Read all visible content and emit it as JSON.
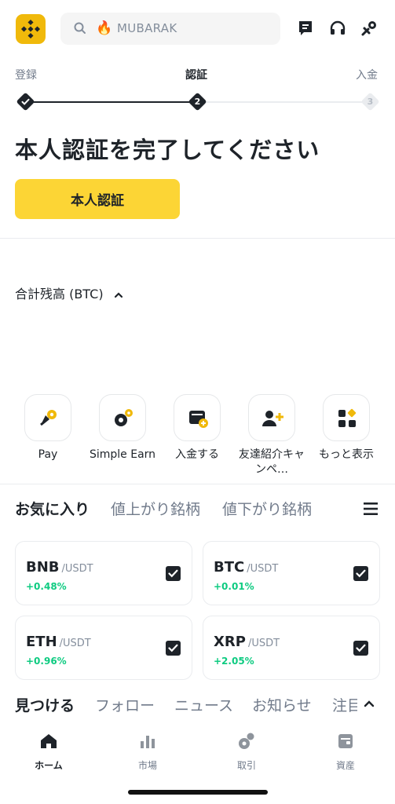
{
  "search": {
    "value": "MUBARAK",
    "emoji": "🔥"
  },
  "stepper": {
    "steps": [
      {
        "label": "登録",
        "state": "done",
        "num": ""
      },
      {
        "label": "認証",
        "state": "current",
        "num": "2"
      },
      {
        "label": "入金",
        "state": "pending",
        "num": "3"
      }
    ]
  },
  "kyc": {
    "title": "本人認証を完了してください",
    "button": "本人認証"
  },
  "balance": {
    "label": "合計残高 (BTC)"
  },
  "quick_actions": [
    {
      "label": "Pay",
      "icon": "pay-icon"
    },
    {
      "label": "Simple Earn",
      "icon": "simple-earn-icon"
    },
    {
      "label": "入金する",
      "icon": "deposit-icon"
    },
    {
      "label": "友達紹介キャンペ…",
      "icon": "referral-icon"
    },
    {
      "label": "もっと表示",
      "icon": "more-icon"
    }
  ],
  "market_tabs": [
    {
      "label": "お気に入り",
      "active": true
    },
    {
      "label": "値上がり銘柄",
      "active": false
    },
    {
      "label": "値下がり銘柄",
      "active": false
    }
  ],
  "coins": [
    {
      "symbol": "BNB",
      "quote": "/USDT",
      "change": "+0.48%"
    },
    {
      "symbol": "BTC",
      "quote": "/USDT",
      "change": "+0.01%"
    },
    {
      "symbol": "ETH",
      "quote": "/USDT",
      "change": "+0.96%"
    },
    {
      "symbol": "XRP",
      "quote": "/USDT",
      "change": "+2.05%"
    }
  ],
  "discover_tabs": [
    "見つける",
    "フォロー",
    "ニュース",
    "お知らせ",
    "注目"
  ],
  "bottom_nav": [
    {
      "label": "ホーム",
      "icon": "home-icon",
      "active": true
    },
    {
      "label": "市場",
      "icon": "markets-icon",
      "active": false
    },
    {
      "label": "取引",
      "icon": "trade-icon",
      "active": false
    },
    {
      "label": "資産",
      "icon": "assets-icon",
      "active": false
    }
  ],
  "colors": {
    "brand": "#f0b90b",
    "button": "#fcd535",
    "positive": "#0ecb81",
    "text": "#1e2329",
    "muted": "#707a8a"
  }
}
